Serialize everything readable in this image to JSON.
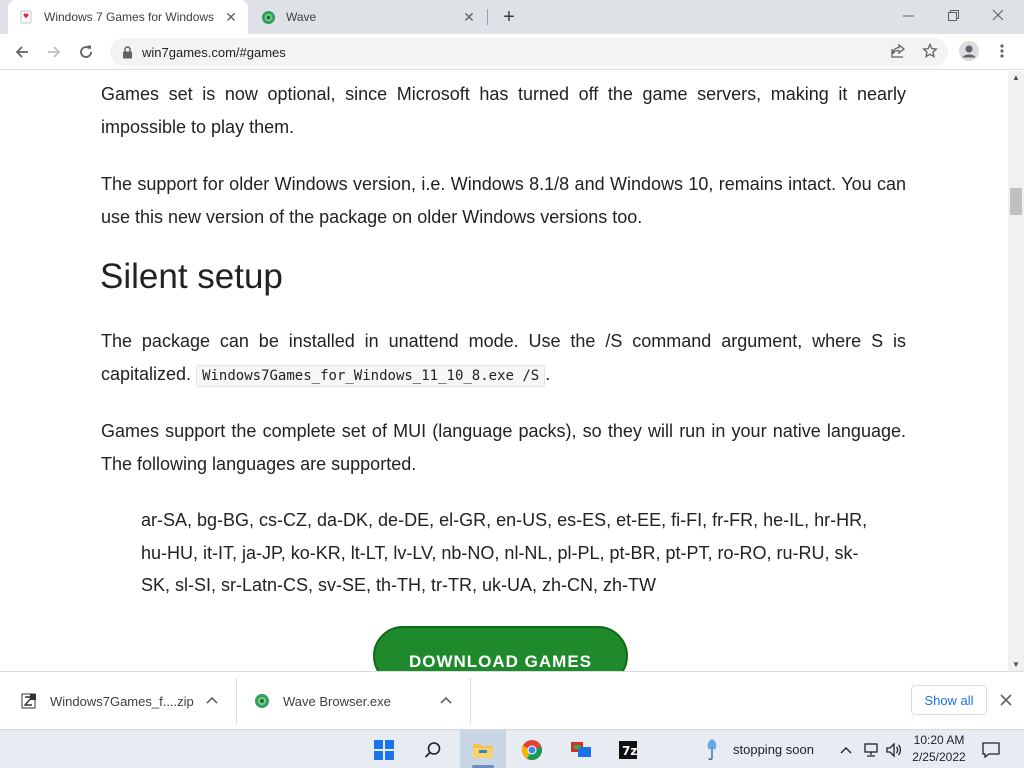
{
  "browser": {
    "tabs": [
      {
        "title": "Windows 7 Games for Windows",
        "active": true,
        "icon": "win7games-favicon"
      },
      {
        "title": "Wave",
        "active": false,
        "icon": "wave-browser-icon"
      }
    ],
    "address": {
      "url": "win7games.com/#games"
    }
  },
  "page": {
    "para1": "Games set is now optional, since Microsoft has turned off the game servers, making it nearly impossible to play them.",
    "para2": "The support for older Windows version, i.e. Windows 8.1/8 and Windows 10, remains intact. You can use this new version of the package on older Windows versions too.",
    "heading": "Silent setup",
    "para3_before": "The package can be installed in unattend mode. Use the /S command argument, where S is capitalized.",
    "para3_code": "Windows7Games_for_Windows_11_10_8.exe /S",
    "para3_after": ".",
    "para4": "Games support the complete set of MUI (language packs), so they will run in your native language. The following languages are supported.",
    "languages": "ar-SA, bg-BG, cs-CZ, da-DK, de-DE, el-GR, en-US, es-ES, et-EE, fi-FI, fr-FR, he-IL, hr-HR, hu-HU, it-IT, ja-JP, ko-KR, lt-LT, lv-LV, nb-NO, nl-NL, pl-PL, pt-BR, pt-PT, ro-RO, ru-RU, sk-SK, sl-SI, sr-Latn-CS, sv-SE, th-TH, tr-TR, uk-UA, zh-CN, zh-TW",
    "download_button": "DOWNLOAD GAMES"
  },
  "downloads": {
    "items": [
      {
        "name": "Windows7Games_f....zip",
        "icon": "zip-file-icon"
      },
      {
        "name": "Wave Browser.exe",
        "icon": "wave-browser-icon"
      }
    ],
    "show_all": "Show all"
  },
  "taskbar": {
    "notification": "stopping soon",
    "time": "10:20 AM",
    "date": "2/25/2022"
  },
  "colors": {
    "download_green": "#1f8a2c",
    "link_blue": "#1a73e8"
  }
}
